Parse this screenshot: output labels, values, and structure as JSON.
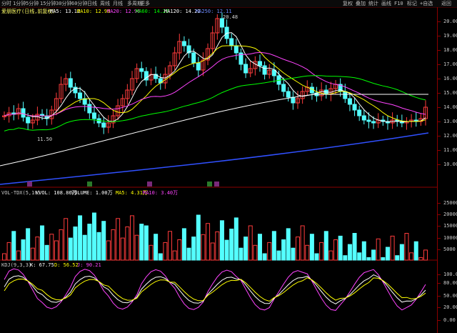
{
  "toolbar": {
    "periods": [
      "分时",
      "1分钟",
      "5分钟",
      "15分钟",
      "30分钟",
      "60分钟",
      "日线",
      "周线",
      "月线",
      "多周期",
      "更多"
    ],
    "right_items": [
      "复权",
      "叠加",
      "统计",
      "画线",
      "F10",
      "标记",
      "+自选",
      "返回"
    ]
  },
  "header": {
    "stock": "爱朋医疗(日线,前复权)",
    "ma5": "MA5: 13.12",
    "ma10": "MA10: 12.99",
    "ma20": "MA20: 12.96",
    "ma60": "MA60: 14.23",
    "ma120": "MA120: 14.22",
    "ma250": "MA250: 12.11"
  },
  "volume_header": {
    "label": "VOL-TDX(5,10)",
    "vvol": "VVOL: 108.86万",
    "volume": "VOLUME: 1.00万",
    "ma5": "MA5: 4.31万",
    "ma10": "MA10: 3.40万"
  },
  "kdj_header": {
    "label": "KDJ(9,3,3)",
    "k": "K: 67.75",
    "d": "D: 56.52",
    "j": "J: 90.21"
  },
  "annotations": {
    "high": "20.48",
    "low": "11.50",
    "marker_labels": [
      "四",
      "四",
      "四",
      "四",
      "四"
    ]
  },
  "axes": {
    "price_ticks": [
      "20.00",
      "19.00",
      "18.00",
      "17.00",
      "16.00",
      "15.00",
      "14.00",
      "13.00",
      "12.00",
      "11.00",
      "10.00"
    ],
    "volume_ticks": [
      "25000",
      "20000",
      "15000",
      "10000",
      "5000"
    ],
    "kdj_ticks": [
      "100.00",
      "80.00",
      "50.00",
      "20.00",
      "0.00"
    ]
  },
  "colors": {
    "up": "#ff3c3c",
    "down": "#54ffff",
    "ma5": "#ffffff",
    "ma10": "#ffff00",
    "ma20": "#ff44ff",
    "ma60": "#00ff00",
    "ma120": "#ffffff",
    "ma250": "#3050ff",
    "kline": "#ffffff",
    "dline": "#ffff00",
    "jline": "#ff44ff"
  },
  "chart_data": {
    "type": "candlestick",
    "price_range": [
      10.0,
      20.0
    ],
    "volume_range": [
      0,
      25000
    ],
    "kdj_range": [
      0,
      100
    ]
  }
}
